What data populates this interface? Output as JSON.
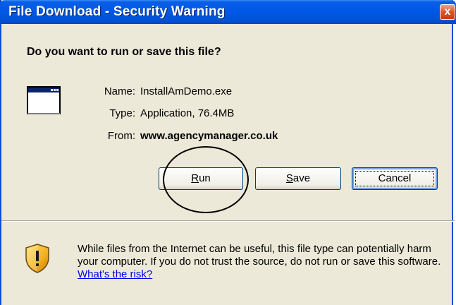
{
  "window": {
    "title": "File Download - Security Warning",
    "close_glyph": "x"
  },
  "dialog": {
    "question": "Do you want to run or save this file?",
    "file_icon": "application-window-icon",
    "fields": {
      "name_label": "Name:",
      "name_value": "InstallAmDemo.exe",
      "type_label": "Type:",
      "type_value": "Application, 76.4MB",
      "from_label": "From:",
      "from_value": "www.agencymanager.co.uk"
    },
    "buttons": {
      "run_mnemonic": "R",
      "run_rest": "un",
      "save_mnemonic": "S",
      "save_rest": "ave",
      "cancel_label": "Cancel"
    }
  },
  "warning": {
    "icon": "shield-warning-icon",
    "text": "While files from the Internet can be useful, this file type can potentially harm your computer. If you do not trust the source, do not run or save this software. ",
    "link_text": "What's the risk?"
  }
}
